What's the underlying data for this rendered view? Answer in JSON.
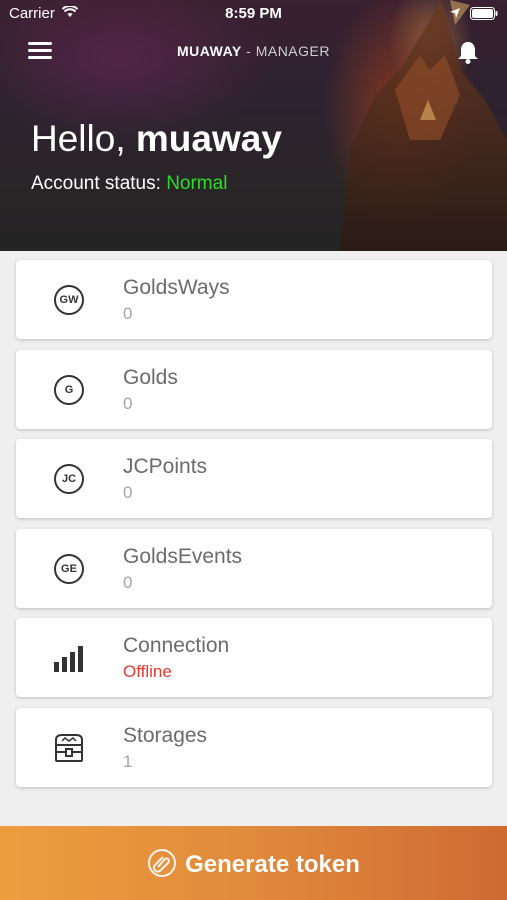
{
  "status_bar": {
    "carrier": "Carrier",
    "time": "8:59 PM"
  },
  "header": {
    "brand": "MUAWAY",
    "separator": " - ",
    "subtitle": "MANAGER"
  },
  "greeting": {
    "hello": "Hello, ",
    "username": "muaway",
    "status_label": "Account status: ",
    "status_value": "Normal",
    "status_color": "#2bdd2b"
  },
  "cards": [
    {
      "icon": "gw-coin-icon",
      "icon_text": "GW",
      "label": "GoldsWays",
      "value": "0"
    },
    {
      "icon": "g-coin-icon",
      "icon_text": "G",
      "label": "Golds",
      "value": "0"
    },
    {
      "icon": "jc-coin-icon",
      "icon_text": "JC",
      "label": "JCPoints",
      "value": "0"
    },
    {
      "icon": "ge-coin-icon",
      "icon_text": "GE",
      "label": "GoldsEvents",
      "value": "0"
    },
    {
      "icon": "signal-bars-icon",
      "label": "Connection",
      "value": "Offline",
      "value_color": "#e53935"
    },
    {
      "icon": "treasure-chest-icon",
      "label": "Storages",
      "value": "1"
    }
  ],
  "footer": {
    "button_label": "Generate token",
    "gradient_start": "#ee9d3e",
    "gradient_end": "#cf6a32"
  }
}
